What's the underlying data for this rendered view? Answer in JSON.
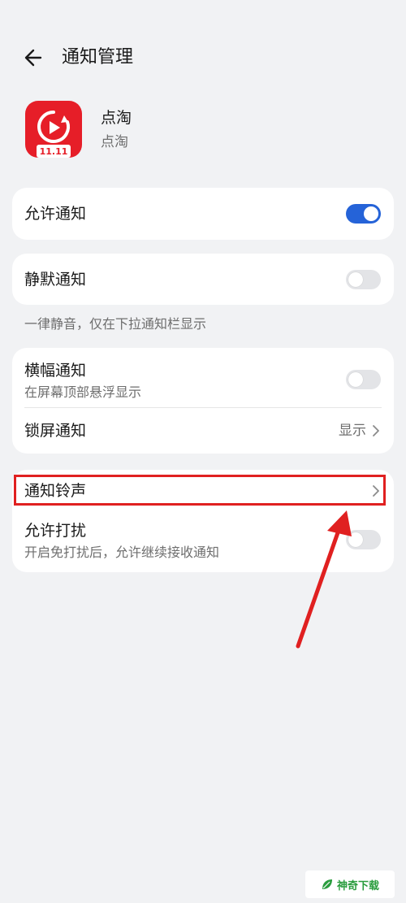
{
  "header": {
    "title": "通知管理",
    "back_icon": "arrow-left-icon"
  },
  "app": {
    "name": "点淘",
    "subtitle": "点淘",
    "icon": "dian-tao-app-icon",
    "icon_badge": "11.11",
    "brand_color": "#e61e28"
  },
  "settings": {
    "allow_notifications": {
      "label": "允许通知",
      "enabled": true
    },
    "silent_notifications": {
      "label": "静默通知",
      "enabled": false,
      "note": "一律静音，仅在下拉通知栏显示"
    },
    "banner_notifications": {
      "label": "横幅通知",
      "description": "在屏幕顶部悬浮显示",
      "enabled": false
    },
    "lockscreen_notifications": {
      "label": "锁屏通知",
      "value": "显示"
    },
    "notification_ringtone": {
      "label": "通知铃声"
    },
    "allow_disturb": {
      "label": "允许打扰",
      "description": "开启免打扰后，允许继续接收通知",
      "enabled": false
    }
  },
  "watermark": {
    "text": "神奇下载"
  },
  "colors": {
    "accent": "#2563d8",
    "annotation": "#e02020",
    "background": "#f1f2f4"
  }
}
